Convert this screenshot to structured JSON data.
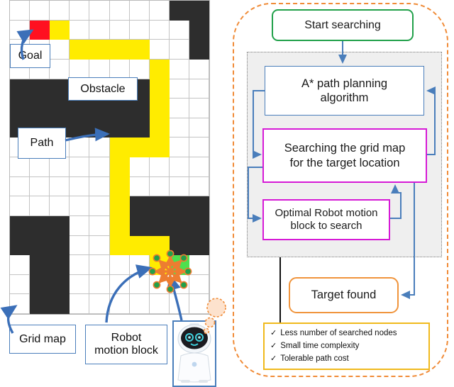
{
  "grid_map": {
    "rows": 16,
    "cols": 10,
    "colors": {
      "free": "#ffffff",
      "obstacle": "#2d2d2d",
      "path": "#ffec00",
      "goal": "#ff1020",
      "robot_block": "#4ee04e",
      "gridline": "#c3c3c3",
      "arrow_blue": "#3b6fb8",
      "motion_arrow": "#ed7d31",
      "motion_node": "#21a04a"
    },
    "goal_cell": [
      1,
      1
    ],
    "robot_cell": [
      13,
      8
    ],
    "path_cells": [
      [
        1,
        2
      ],
      [
        2,
        3
      ],
      [
        2,
        4
      ],
      [
        2,
        5
      ],
      [
        2,
        6
      ],
      [
        3,
        7
      ],
      [
        4,
        7
      ],
      [
        5,
        7
      ],
      [
        6,
        7
      ],
      [
        7,
        7
      ],
      [
        7,
        6
      ],
      [
        7,
        5
      ],
      [
        8,
        5
      ],
      [
        9,
        5
      ],
      [
        10,
        5
      ],
      [
        11,
        5
      ],
      [
        12,
        5
      ],
      [
        12,
        6
      ],
      [
        13,
        7
      ],
      [
        12,
        7
      ]
    ],
    "obstacle_cells": [
      [
        0,
        8
      ],
      [
        0,
        9
      ],
      [
        1,
        9
      ],
      [
        2,
        9
      ],
      [
        4,
        0
      ],
      [
        4,
        1
      ],
      [
        4,
        2
      ],
      [
        4,
        3
      ],
      [
        4,
        4
      ],
      [
        4,
        5
      ],
      [
        4,
        6
      ],
      [
        5,
        0
      ],
      [
        5,
        1
      ],
      [
        5,
        2
      ],
      [
        5,
        3
      ],
      [
        5,
        4
      ],
      [
        5,
        5
      ],
      [
        5,
        6
      ],
      [
        6,
        0
      ],
      [
        6,
        1
      ],
      [
        6,
        2
      ],
      [
        6,
        3
      ],
      [
        6,
        4
      ],
      [
        6,
        5
      ],
      [
        6,
        6
      ],
      [
        10,
        6
      ],
      [
        10,
        7
      ],
      [
        10,
        8
      ],
      [
        10,
        9
      ],
      [
        11,
        0
      ],
      [
        11,
        1
      ],
      [
        11,
        2
      ],
      [
        11,
        6
      ],
      [
        11,
        7
      ],
      [
        11,
        8
      ],
      [
        11,
        9
      ],
      [
        12,
        0
      ],
      [
        12,
        1
      ],
      [
        12,
        2
      ],
      [
        12,
        8
      ],
      [
        12,
        9
      ],
      [
        13,
        1
      ],
      [
        13,
        2
      ],
      [
        14,
        1
      ],
      [
        14,
        2
      ],
      [
        15,
        1
      ],
      [
        15,
        2
      ]
    ],
    "callouts": {
      "goal": "Goal",
      "obstacle": "Obstacle",
      "path": "Path",
      "grid_map": "Grid map",
      "robot_motion_block_line1": "Robot",
      "robot_motion_block_line2": "motion block"
    },
    "robot_avatar_name": "robot-illustration"
  },
  "flowchart": {
    "nodes": {
      "start": "Start searching",
      "astar_line1": "A* path planning",
      "astar_line2": "algorithm",
      "search_line1": "Searching the grid map",
      "search_line2": "for the target location",
      "optimal_line1": "Optimal Robot motion",
      "optimal_line2": "block to search",
      "target": "Target found"
    },
    "benefits": [
      "Less number of searched nodes",
      "Small time complexity",
      "Tolerable path cost"
    ],
    "check_glyph": "✓",
    "colors": {
      "start_border": "#21a04a",
      "astar_border": "#4a7ebb",
      "magenta_border": "#d61ad6",
      "target_border": "#f0943c",
      "benefits_border": "#f0b91c",
      "region_fill": "#efefef",
      "region_border": "#7a7a7a",
      "outer_dash": "#f08b37",
      "connector": "#4a7ebb",
      "connector_black": "#111111"
    }
  }
}
